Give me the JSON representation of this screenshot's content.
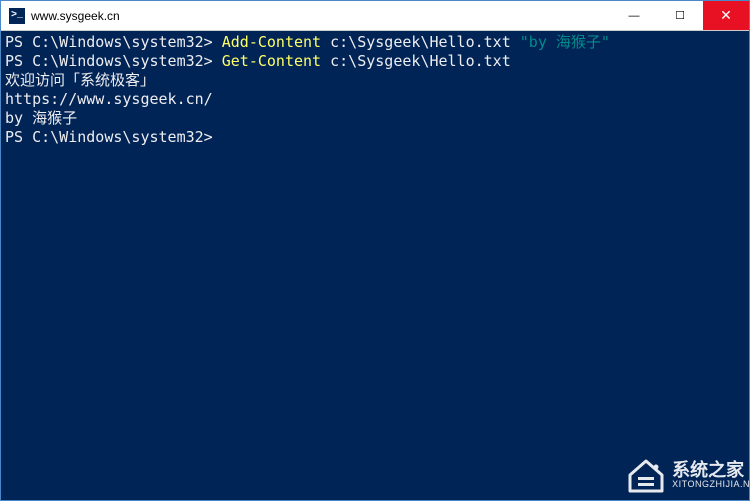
{
  "window": {
    "title": "www.sysgeek.cn",
    "icon_label": ">_"
  },
  "controls": {
    "minimize": "—",
    "maximize": "☐",
    "close": "✕"
  },
  "terminal": {
    "lines": [
      {
        "prompt": "PS C:\\Windows\\system32>",
        "cmdlet": "Add-Content",
        "arg": "c:\\Sysgeek\\Hello.txt",
        "string": "\"by 海猴子\""
      },
      {
        "prompt": "PS C:\\Windows\\system32>",
        "cmdlet": "Get-Content",
        "arg": "c:\\Sysgeek\\Hello.txt"
      }
    ],
    "output": [
      "欢迎访问「系统极客」",
      "",
      "https://www.sysgeek.cn/",
      "",
      "by 海猴子"
    ],
    "final_prompt": "PS C:\\Windows\\system32>"
  },
  "watermark": {
    "title": "系统之家",
    "sub": "XITONGZHIJIA.N"
  }
}
